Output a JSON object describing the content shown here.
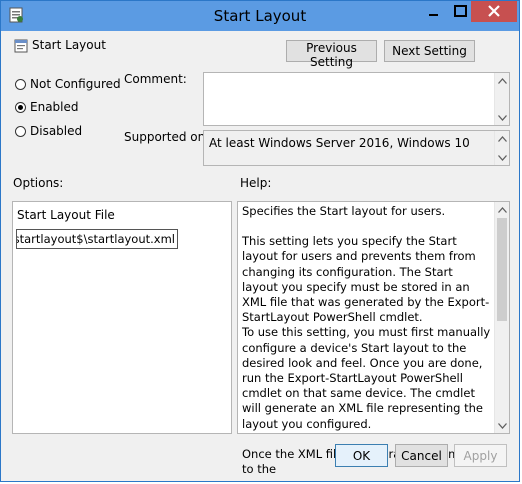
{
  "window": {
    "title": "Start Layout",
    "colors": {
      "titlebar": "#5b9be3",
      "close_button": "#c75050",
      "window_bg": "#f0f0f0"
    }
  },
  "setting": {
    "name": "Start Layout",
    "icon": "policy-setting-icon"
  },
  "nav": {
    "previous_label": "Previous Setting",
    "next_label": "Next Setting"
  },
  "state": {
    "options": [
      {
        "label": "Not Configured",
        "selected": false
      },
      {
        "label": "Enabled",
        "selected": true
      },
      {
        "label": "Disabled",
        "selected": false
      }
    ]
  },
  "comment": {
    "label": "Comment:",
    "value": ""
  },
  "supported": {
    "label": "Supported on:",
    "value": "At least Windows Server 2016, Windows 10"
  },
  "options_section": {
    "label": "Options:",
    "field_label": "Start Layout File",
    "field_value": "ocal\\startlayout$\\startlayout.xml"
  },
  "help": {
    "label": "Help:",
    "paragraphs": [
      "Specifies the Start layout for users.",
      "This setting lets you specify the Start layout for users and prevents them from changing its configuration. The Start layout you specify must be stored in an XML file that was generated by the Export-StartLayout PowerShell cmdlet.",
      "To use this setting, you must first manually configure a device's Start layout to the desired look and feel. Once you are done, run the Export-StartLayout PowerShell cmdlet on that same device. The cmdlet will generate an XML file representing the layout you configured.",
      "Once the XML file is generated and moved to the"
    ]
  },
  "footer": {
    "ok_label": "OK",
    "cancel_label": "Cancel",
    "apply_label": "Apply"
  }
}
